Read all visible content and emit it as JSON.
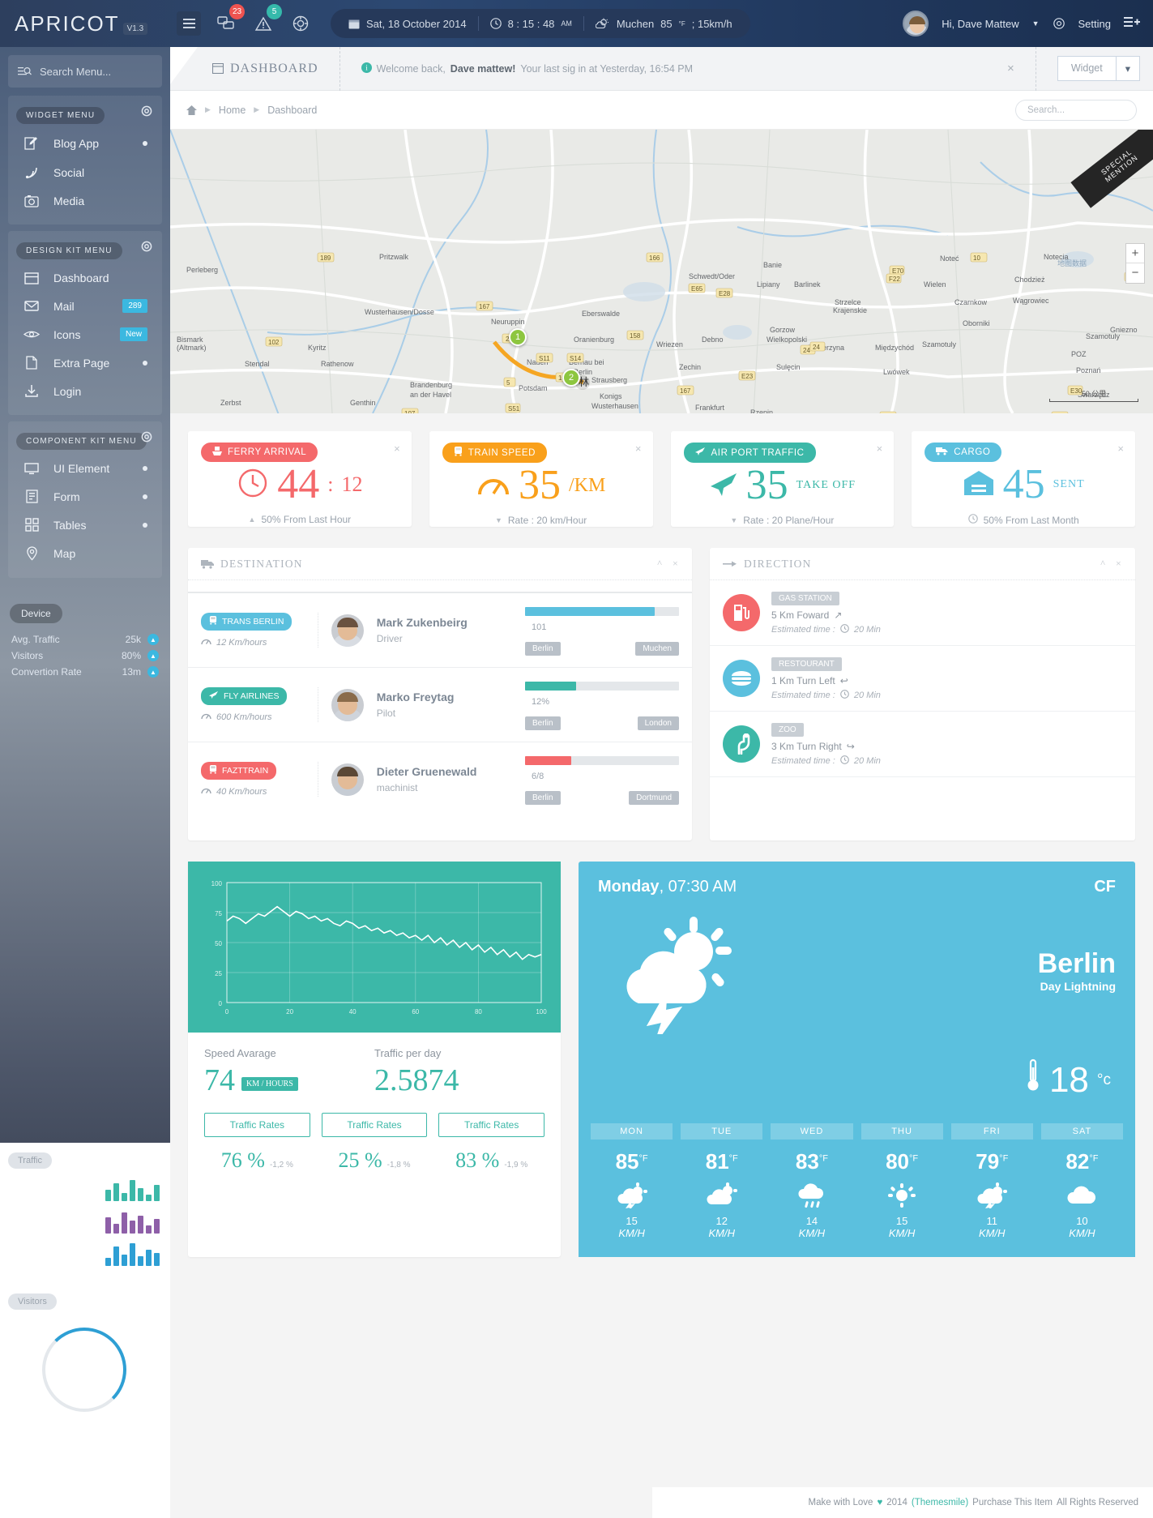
{
  "topbar": {
    "logo": "APRICOT",
    "version": "V1.3",
    "messages_badge": "23",
    "alerts_badge": "5",
    "date": "Sat, 18 October 2014",
    "time": "8 : 15 : 48",
    "time_ampm": "AM",
    "city": "Muchen",
    "temp": "85",
    "temp_unit": "°F",
    "wind": "; 15km/h",
    "greeting": "Hi, Dave Mattew",
    "setting": "Setting"
  },
  "sidebar": {
    "search_placeholder": "Search Menu...",
    "groups": [
      {
        "caption": "WIDGET MENU",
        "items": [
          {
            "label": "Blog App",
            "icon": "pencil-square-icon",
            "marker": "dot"
          },
          {
            "label": "Social",
            "icon": "rss-icon",
            "marker": ""
          },
          {
            "label": "Media",
            "icon": "camera-icon",
            "marker": ""
          }
        ]
      },
      {
        "caption": "DESIGN KIT MENU",
        "items": [
          {
            "label": "Dashboard",
            "icon": "window-icon",
            "marker": ""
          },
          {
            "label": "Mail",
            "icon": "envelope-icon",
            "marker": "badge",
            "badge": "289"
          },
          {
            "label": "Icons",
            "icon": "eye-icon",
            "marker": "badge",
            "badge": "New"
          },
          {
            "label": "Extra Page",
            "icon": "file-icon",
            "marker": "dot"
          },
          {
            "label": "Login",
            "icon": "download-icon",
            "marker": ""
          }
        ]
      },
      {
        "caption": "COMPONENT KIT MENU",
        "items": [
          {
            "label": "UI Element",
            "icon": "monitor-icon",
            "marker": "dot"
          },
          {
            "label": "Form",
            "icon": "form-icon",
            "marker": "dot"
          },
          {
            "label": "Tables",
            "icon": "grid-icon",
            "marker": "dot"
          },
          {
            "label": "Map",
            "icon": "map-pin-icon",
            "marker": ""
          }
        ]
      }
    ],
    "device_caption": "Device",
    "device_stats": [
      {
        "label": "Avg. Traffic",
        "value": "25k"
      },
      {
        "label": "Visitors",
        "value": "80%"
      },
      {
        "label": "Convertion Rate",
        "value": "13m"
      }
    ],
    "traffic_label": "Traffic",
    "visitors_label": "Visitors"
  },
  "pagehead": {
    "title": "DASHBOARD",
    "welcome_prefix": "Welcome back,",
    "welcome_user": "Dave mattew!",
    "welcome_suffix": "Your last sig in at Yesterday, 16:54 PM",
    "widget_label": "Widget"
  },
  "breadcrumb": {
    "home": "Home",
    "current": "Dashboard",
    "search_placeholder": "Search..."
  },
  "map": {
    "ribbon_line1": "SPECIAL",
    "ribbon_line2": "MENTION",
    "markers": [
      {
        "label": "1"
      },
      {
        "label": "2"
      }
    ],
    "scale": "50 公里",
    "zoom_in": "+",
    "zoom_out": "−"
  },
  "stat_cards": [
    {
      "title": "FERRY ARRIVAL",
      "icon": "ferry-icon",
      "color": "#f4696b",
      "main_icon": "clock-icon",
      "value": "44",
      "sep": ":",
      "value2": "12",
      "unit": "",
      "foot_icon": "up-triangle",
      "foot": "50%  From Last Hour"
    },
    {
      "title": "TRAIN SPEED",
      "icon": "train-icon",
      "color": "#f9a01b",
      "main_icon": "gauge-icon",
      "value": "35",
      "sep": "",
      "value2": "",
      "unit": "/KM",
      "foot_icon": "down-triangle",
      "foot": "Rate : 20 km/Hour"
    },
    {
      "title": "AIR PORT TRAFFIC",
      "icon": "plane-icon",
      "color": "#3cb8a8",
      "main_icon": "plane-icon",
      "value": "35",
      "sep": "",
      "value2": "",
      "unit": "TAKE OFF",
      "foot_icon": "down-triangle",
      "foot": "Rate : 20 Plane/Hour"
    },
    {
      "title": "CARGO",
      "icon": "truck-icon",
      "color": "#5bc0de",
      "main_icon": "warehouse-icon",
      "value": "45",
      "sep": "",
      "value2": "",
      "unit": "SENT",
      "foot_icon": "clock-small",
      "foot": "50% From Last Month"
    }
  ],
  "destination": {
    "title": "DESTINATION",
    "rows": [
      {
        "badge": "TRANS BERLIN",
        "badge_color": "#5bc0de",
        "badge_icon": "train-icon",
        "speed": "12 Km/hours",
        "name": "Mark Zukenbeirg",
        "role": "Driver",
        "progress": 84,
        "progress_label": "101",
        "bar_color": "#5bc0de",
        "tag_left": "Berlin",
        "tag_right": "Muchen"
      },
      {
        "badge": "FLY AIRLINES",
        "badge_color": "#3cb8a8",
        "badge_icon": "plane-icon",
        "speed": "600 Km/hours",
        "name": "Marko Freytag",
        "role": "Pilot",
        "progress": 33,
        "progress_label": "12%",
        "bar_color": "#3cb8a8",
        "tag_left": "Berlin",
        "tag_right": "London"
      },
      {
        "badge": "FAZTTRAIN",
        "badge_color": "#f4696b",
        "badge_icon": "train-icon",
        "speed": "40 Km/hours",
        "name": "Dieter Gruenewald",
        "role": "machinist",
        "progress": 30,
        "progress_label": "6/8",
        "bar_color": "#f4696b",
        "tag_left": "Berlin",
        "tag_right": "Dortmund"
      }
    ]
  },
  "direction": {
    "title": "DIRECTION",
    "rows": [
      {
        "tag": "GAS STATION",
        "icon": "fuel-icon",
        "color": "#f4696b",
        "text": "5 Km Foward",
        "dir_icon": "arrow-up",
        "eta_label": "Estimated time :",
        "eta": "20 Min"
      },
      {
        "tag": "RESTOURANT",
        "icon": "burger-icon",
        "color": "#5bc0de",
        "text": "1 Km Turn Left",
        "dir_icon": "arrow-left",
        "eta_label": "Estimated time :",
        "eta": "20 Min"
      },
      {
        "tag": "ZOO",
        "icon": "giraffe-icon",
        "color": "#3cb8a8",
        "text": "3 Km Turn Right",
        "dir_icon": "arrow-right",
        "eta_label": "Estimated time :",
        "eta": "20 Min"
      }
    ]
  },
  "traffic_panel": {
    "speed_label": "Speed Avarage",
    "speed_value": "74",
    "speed_unit": "KM / HOURS",
    "per_day_label": "Traffic per day",
    "per_day_value": "2.5874",
    "rate_buttons": [
      "Traffic Rates",
      "Traffic Rates",
      "Traffic Rates"
    ],
    "percents": [
      {
        "value": "76 %",
        "delta": "-1,2 %"
      },
      {
        "value": "25 %",
        "delta": "-1,8 %"
      },
      {
        "value": "83 %",
        "delta": "-1,9 %"
      }
    ]
  },
  "weather": {
    "day": "Monday",
    "time": ", 07:30 AM",
    "cf": "CF",
    "city": "Berlin",
    "condition": "Day Lightning",
    "temp": "18",
    "temp_unit": "°c",
    "icon": "storm-sun-icon",
    "forecast": [
      {
        "day": "MON",
        "temp": "85",
        "unit": "°F",
        "icon": "storm-sun-icon",
        "wind": "15",
        "wind_unit": "KM/H"
      },
      {
        "day": "TUE",
        "temp": "81",
        "unit": "°F",
        "icon": "cloud-sun-icon",
        "wind": "12",
        "wind_unit": "KM/H"
      },
      {
        "day": "WED",
        "temp": "83",
        "unit": "°F",
        "icon": "rain-icon",
        "wind": "14",
        "wind_unit": "KM/H"
      },
      {
        "day": "THU",
        "temp": "80",
        "unit": "°F",
        "icon": "sun-icon",
        "wind": "15",
        "wind_unit": "KM/H"
      },
      {
        "day": "FRI",
        "temp": "79",
        "unit": "°F",
        "icon": "storm-sun-icon",
        "wind": "11",
        "wind_unit": "KM/H"
      },
      {
        "day": "SAT",
        "temp": "82",
        "unit": "°F",
        "icon": "cloud-icon",
        "wind": "10",
        "wind_unit": "KM/H"
      }
    ]
  },
  "chart_data": {
    "type": "line",
    "title": "",
    "xlabel": "",
    "ylabel": "",
    "xlim": [
      0,
      100
    ],
    "ylim": [
      0,
      100
    ],
    "xticks": [
      0,
      20,
      40,
      60,
      80,
      100
    ],
    "yticks": [
      0,
      25,
      50,
      75,
      100
    ],
    "grid": true,
    "line_color": "#ffffff",
    "bg_color": "#3cb8a8",
    "x": [
      0,
      2,
      4,
      6,
      8,
      10,
      12,
      14,
      16,
      18,
      20,
      22,
      24,
      26,
      28,
      30,
      32,
      34,
      36,
      38,
      40,
      42,
      44,
      46,
      48,
      50,
      52,
      54,
      56,
      58,
      60,
      62,
      64,
      66,
      68,
      70,
      72,
      74,
      76,
      78,
      80,
      82,
      84,
      86,
      88,
      90,
      92,
      94,
      96,
      98,
      100
    ],
    "y": [
      68,
      72,
      70,
      66,
      70,
      74,
      72,
      76,
      80,
      76,
      72,
      76,
      74,
      70,
      72,
      68,
      70,
      66,
      64,
      68,
      66,
      62,
      64,
      60,
      62,
      58,
      60,
      56,
      58,
      54,
      56,
      52,
      56,
      50,
      54,
      48,
      52,
      46,
      50,
      44,
      48,
      42,
      46,
      40,
      44,
      38,
      42,
      36,
      40,
      38,
      40
    ]
  },
  "sidebar_charts": {
    "traffic_bars": [
      {
        "values": [
          14,
          22,
          10,
          26,
          16,
          8,
          20
        ],
        "color": "#3cb8a8"
      },
      {
        "values": [
          20,
          12,
          26,
          16,
          22,
          10,
          18
        ],
        "color": "#8e5fa8"
      },
      {
        "values": [
          10,
          24,
          14,
          28,
          12,
          20,
          16
        ],
        "color": "#2e9fd4"
      }
    ],
    "visitors_ring": {
      "percent": 72,
      "color": "#2e9fd4",
      "track": "#e4e8ec"
    }
  },
  "footer": {
    "prefix": "Make with Love",
    "heart": "♥",
    "year": "2014",
    "link": "(Themesmile)",
    "mid": "Purchase This Item",
    "suffix": "All Rights Reserved"
  }
}
